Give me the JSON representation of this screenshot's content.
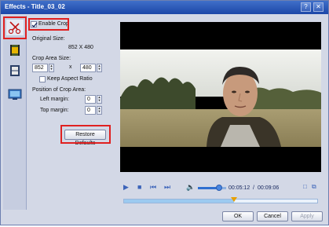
{
  "window": {
    "title": "Effects - Title_03_02",
    "help_icon": "help-icon",
    "close_icon": "close-icon"
  },
  "sidebar": {
    "items": [
      {
        "name": "crop",
        "icon": "crop-icon"
      },
      {
        "name": "video-effects",
        "icon": "film-icon"
      },
      {
        "name": "trim",
        "icon": "film-strip-icon"
      },
      {
        "name": "watermark",
        "icon": "screen-icon"
      }
    ]
  },
  "crop": {
    "enable_label": "Enable Crop",
    "enabled": true,
    "original_size_label": "Original Size:",
    "original_size_value": "852 X 480",
    "area_size_label": "Crop Area Size:",
    "width": "852",
    "x_sep": "x",
    "height": "480",
    "keep_aspect_label": "Keep Aspect Ratio",
    "keep_aspect": false,
    "position_label": "Position of Crop Area:",
    "left_margin_label": "Left margin:",
    "left_margin": "0",
    "top_margin_label": "Top margin:",
    "top_margin": "0",
    "restore_label": "Restore Defaults"
  },
  "player": {
    "time_current": "00:05:12",
    "time_sep": "/",
    "time_total": "00:09:06",
    "progress": 0.57,
    "volume": 0.75
  },
  "footer": {
    "ok_label": "OK",
    "cancel_label": "Cancel",
    "apply_label": "Apply"
  },
  "colors": {
    "highlight": "#e02020",
    "accent": "#3b63b9"
  }
}
